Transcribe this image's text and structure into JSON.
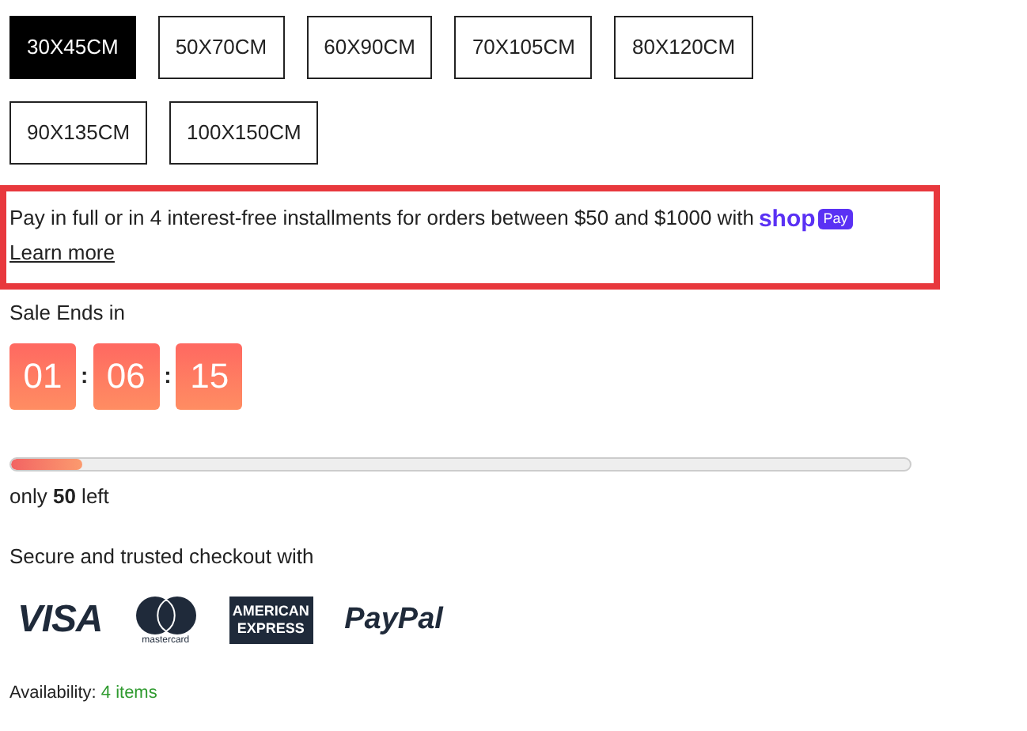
{
  "sizes": [
    {
      "label": "30X45CM",
      "selected": true
    },
    {
      "label": "50X70CM",
      "selected": false
    },
    {
      "label": "60X90CM",
      "selected": false
    },
    {
      "label": "70X105CM",
      "selected": false
    },
    {
      "label": "80X120CM",
      "selected": false
    },
    {
      "label": "90X135CM",
      "selected": false
    },
    {
      "label": "100X150CM",
      "selected": false
    }
  ],
  "installments": {
    "text": "Pay in full or in 4 interest-free installments for orders between $50 and $1000 with",
    "logo_word": "shop",
    "logo_badge": "Pay",
    "link": "Learn more"
  },
  "sale": {
    "label": "Sale Ends in",
    "countdown": [
      "01",
      "06",
      "15"
    ],
    "separator": ":"
  },
  "stock": {
    "level": 0.08,
    "text": "only **50** left"
  },
  "checkout": {
    "label": "Secure and trusted checkout with",
    "payment_methods": [
      {
        "kind": "visa",
        "label": "VISA"
      },
      {
        "kind": "mastercard",
        "label": "mastercard"
      },
      {
        "kind": "amex",
        "label": "AMERICAN EXPRESS"
      },
      {
        "kind": "paypal",
        "label": "PayPal"
      }
    ]
  },
  "availability": {
    "label": "Availability:",
    "value": "4 items"
  }
}
